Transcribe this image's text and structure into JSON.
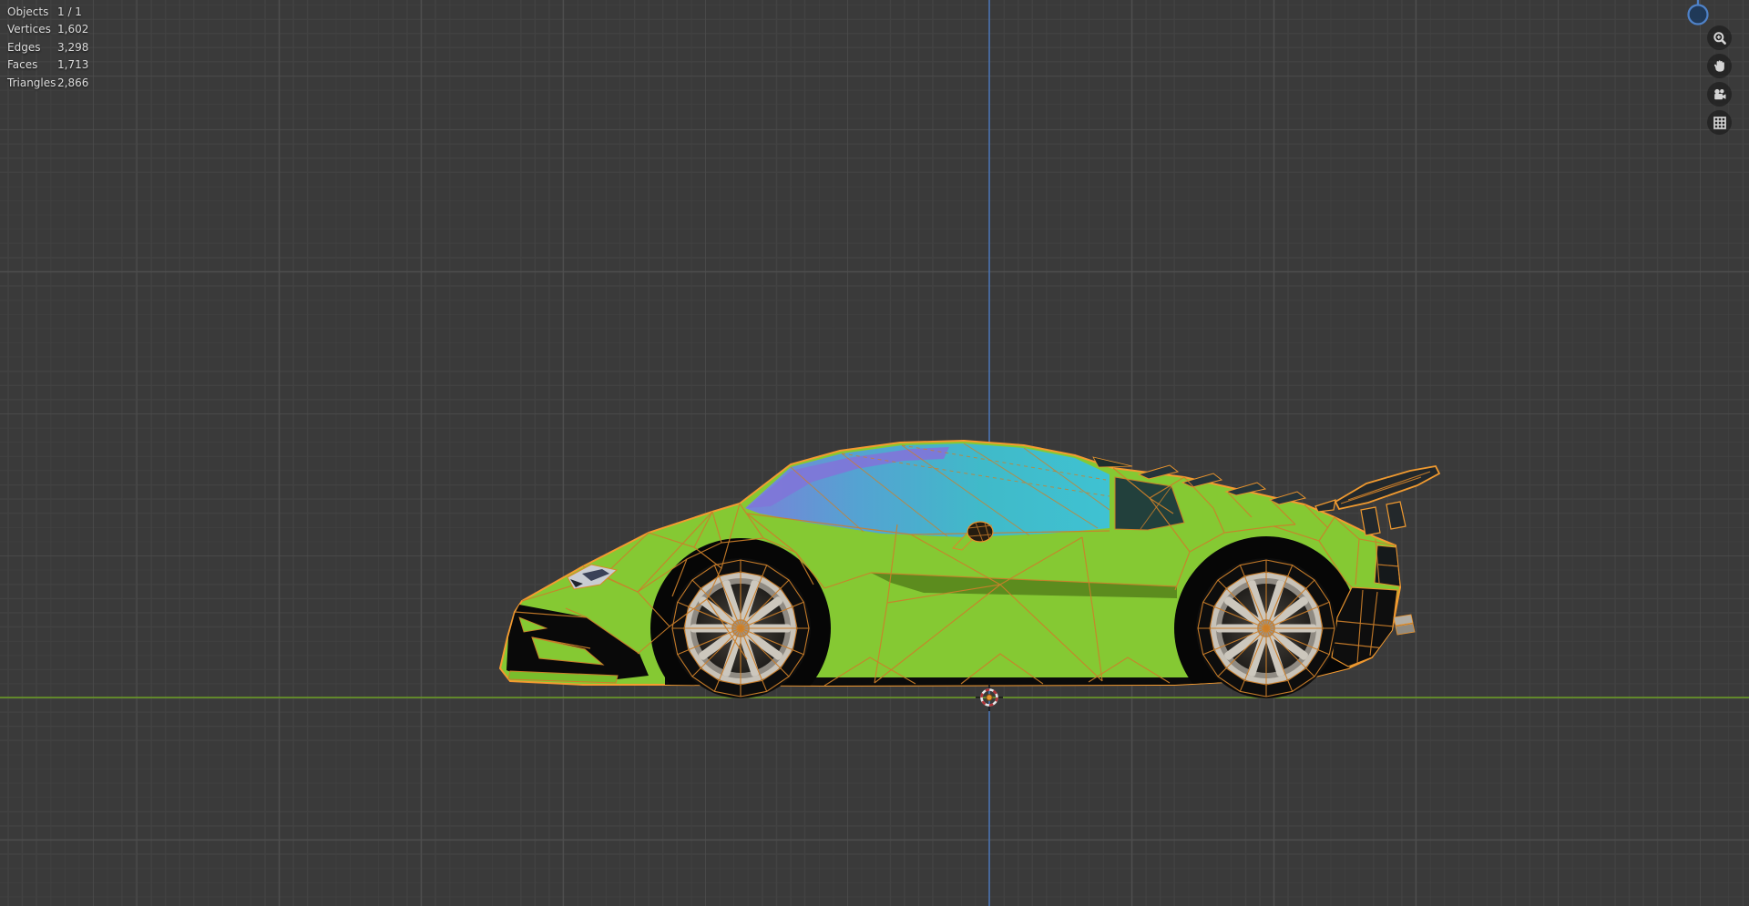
{
  "stats": {
    "rows": [
      {
        "label": "Objects",
        "value": "1 / 1"
      },
      {
        "label": "Vertices",
        "value": "1,602"
      },
      {
        "label": "Edges",
        "value": "3,298"
      },
      {
        "label": "Faces",
        "value": "1,713"
      },
      {
        "label": "Triangles",
        "value": "2,866"
      }
    ]
  },
  "nav_controls": {
    "buttons": [
      {
        "name": "zoom",
        "icon": "magnifier-plus-icon"
      },
      {
        "name": "pan",
        "icon": "hand-icon"
      },
      {
        "name": "camera-view",
        "icon": "camera-icon"
      },
      {
        "name": "grid-toggle",
        "icon": "grid-icon"
      }
    ],
    "gizmo": {
      "icon": "axis-ball-icon"
    }
  },
  "colors": {
    "viewport_bg": "#3a3a3a",
    "grid_minor": "#424242",
    "grid_major": "#4e4e4e",
    "axis_y_green": "#6b9e22",
    "axis_z_blue": "#4a72b0",
    "body_green": "#85c933",
    "body_green_dark": "#5c8c1e",
    "wire_orange": "#cc7f2a",
    "outline_orange": "#f59b30",
    "glass_cyan": "#3fbccd",
    "glass_blue": "#6b8fd6",
    "glass_purple": "#7e77d8",
    "window_dark": "#22403c",
    "black_parts": "#0b0b0b",
    "rim_silver": "#c7c2b8",
    "gizmo_blue": "#4f82c8",
    "cursor_red": "#b13438",
    "cursor_center": "#e8972f",
    "icon_fg": "#d4d4d4",
    "text": "#dcdcdc"
  }
}
